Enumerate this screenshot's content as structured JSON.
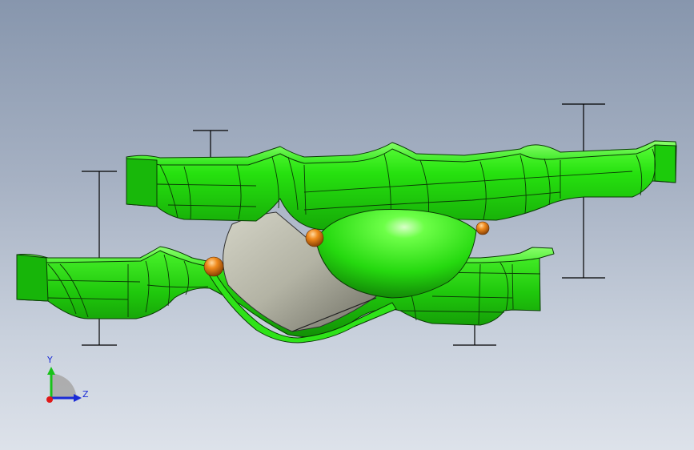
{
  "viewport": {
    "background_top": "#8796ad",
    "background_bottom": "#dde2ea"
  },
  "model": {
    "part_color": "#22e612",
    "edge_color": "#0b3a06",
    "cylinder_color": "#b4b4a6",
    "ball_color": "#e07a12"
  },
  "triad": {
    "y_label": "Y",
    "z_label": "Z",
    "y_axis_color": "#18c218",
    "z_axis_color": "#1a2bd6",
    "origin_color": "#e01818"
  }
}
